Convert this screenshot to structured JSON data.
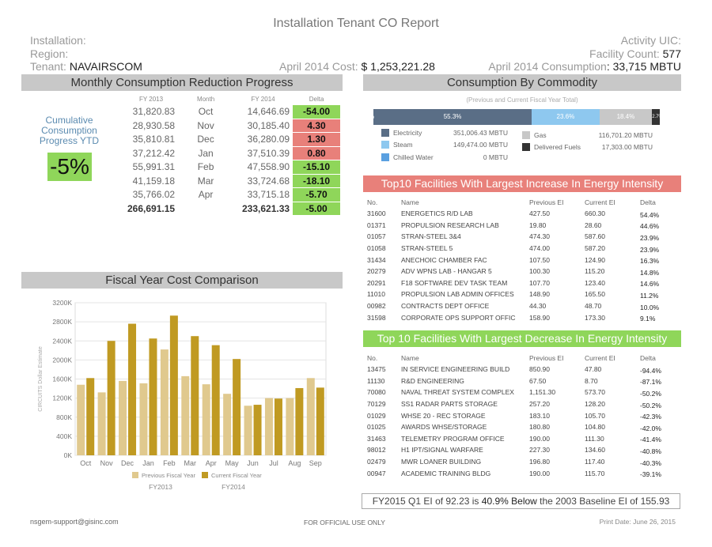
{
  "report": {
    "title": "Installation Tenant CO Report",
    "installation_label": "Installation:",
    "region_label": "Region:",
    "tenant_label": "Tenant:",
    "tenant_value": "NAVAIRSCOM",
    "activity_uic_label": "Activity UIC:",
    "facility_count_label": "Facility Count:",
    "facility_count_value": "577",
    "cost_label": "April 2014 Cost:",
    "cost_value": "$ 1,253,221.28",
    "consumption_label": "April 2014 Consumption",
    "consumption_value": ": 33,715 MBTU"
  },
  "monthly": {
    "title": "Monthly Consumption Reduction Progress",
    "headers": [
      "FY 2013",
      "Month",
      "FY 2014",
      "Delta"
    ],
    "rows": [
      {
        "fy13": "31,820.83",
        "month": "Oct",
        "fy14": "14,646.69",
        "delta": "-54.00",
        "status": "green"
      },
      {
        "fy13": "28,930.58",
        "month": "Nov",
        "fy14": "30,185.40",
        "delta": "4.30",
        "status": "red"
      },
      {
        "fy13": "35,810.81",
        "month": "Dec",
        "fy14": "36,280.09",
        "delta": "1.30",
        "status": "red"
      },
      {
        "fy13": "37,212.42",
        "month": "Jan",
        "fy14": "37,510.39",
        "delta": "0.80",
        "status": "red"
      },
      {
        "fy13": "55,991.31",
        "month": "Feb",
        "fy14": "47,558.90",
        "delta": "-15.10",
        "status": "green"
      },
      {
        "fy13": "41,159.18",
        "month": "Mar",
        "fy14": "33,724.68",
        "delta": "-18.10",
        "status": "green"
      },
      {
        "fy13": "35,766.02",
        "month": "Apr",
        "fy14": "33,715.18",
        "delta": "-5.70",
        "status": "green"
      }
    ],
    "total": {
      "fy13": "266,691.15",
      "fy14": "233,621.33",
      "delta": "-5.00"
    },
    "cumulative_label_1": "Cumulative",
    "cumulative_label_2": "Consumption",
    "cumulative_label_3": "Progress YTD",
    "cumulative_value": "-5%"
  },
  "commodity": {
    "title": "Consumption By Commodity",
    "subtitle": "(Previous and Current Fiscal Year Total)",
    "segments": [
      {
        "label": "55.3%",
        "share": 0.553,
        "color": "#5a6e86"
      },
      {
        "label": "23.6%",
        "share": 0.236,
        "color": "#8ec8ef"
      },
      {
        "label": "18.4%",
        "share": 0.184,
        "color": "#c8c8c8"
      },
      {
        "label": "2.7%",
        "share": 0.027,
        "color": "#333333"
      }
    ],
    "left_cut_label": "%",
    "legend": [
      {
        "name": "Electricity",
        "value": "351,006.43 MBTU",
        "color": "#5a6e86"
      },
      {
        "name": "Steam",
        "value": "149,474.00 MBTU",
        "color": "#8ec8ef"
      },
      {
        "name": "Chilled Water",
        "value": "0 MBTU",
        "color": "#5aa0e0"
      },
      {
        "name": "Gas",
        "value": "116,701.20 MBTU",
        "color": "#c8c8c8"
      },
      {
        "name": "Delivered Fuels",
        "value": "17,303.00 MBTU",
        "color": "#333333"
      }
    ]
  },
  "increase": {
    "title": "Top10 Facilities With Largest Increase In Energy Intensity",
    "headers": [
      "No.",
      "Name",
      "Previous EI",
      "Current EI",
      "Delta"
    ],
    "rows": [
      [
        "31600",
        "ENERGETICS R/D LAB",
        "427.50",
        "660.30",
        "54.4%"
      ],
      [
        "01371",
        "PROPULSION RESEARCH LAB",
        "19.80",
        "28.60",
        "44.6%"
      ],
      [
        "01057",
        "STRAN-STEEL 3&4",
        "474.30",
        "587.60",
        "23.9%"
      ],
      [
        "01058",
        "STRAN-STEEL 5",
        "474.00",
        "587.20",
        "23.9%"
      ],
      [
        "31434",
        "ANECHOIC CHAMBER FAC",
        "107.50",
        "124.90",
        "16.3%"
      ],
      [
        "20279",
        "ADV WPNS LAB - HANGAR 5",
        "100.30",
        "115.20",
        "14.8%"
      ],
      [
        "20291",
        "F18 SOFTWARE DEV TASK TEAM",
        "107.70",
        "123.40",
        "14.6%"
      ],
      [
        "11010",
        "PROPULSION LAB ADMIN OFFICES",
        "148.90",
        "165.50",
        "11.2%"
      ],
      [
        "00982",
        "CONTRACTS DEPT OFFICE",
        "44.30",
        "48.70",
        "10.0%"
      ],
      [
        "31598",
        "CORPORATE OPS SUPPORT OFFIC",
        "158.90",
        "173.30",
        "9.1%"
      ]
    ]
  },
  "decrease": {
    "title": "Top 10 Facilities With Largest Decrease In Energy Intensity",
    "headers": [
      "No.",
      "Name",
      "Previous EI",
      "Current EI",
      "Delta"
    ],
    "rows": [
      [
        "13475",
        "IN SERVICE ENGINEERING BUILD",
        "850.90",
        "47.80",
        "-94.4%"
      ],
      [
        "11130",
        "R&D ENGINEERING",
        "67.50",
        "8.70",
        "-87.1%"
      ],
      [
        "70080",
        "NAVAL THREAT SYSTEM COMPLEX",
        "1,151.30",
        "573.70",
        "-50.2%"
      ],
      [
        "70129",
        "SS1 RADAR PARTS STORAGE",
        "257.20",
        "128.20",
        "-50.2%"
      ],
      [
        "01029",
        "WHSE 20 - REC STORAGE",
        "183.10",
        "105.70",
        "-42.3%"
      ],
      [
        "01025",
        "AWARDS WHSE/STORAGE",
        "180.80",
        "104.80",
        "-42.0%"
      ],
      [
        "31463",
        "TELEMETRY PROGRAM OFFICE",
        "190.00",
        "111.30",
        "-41.4%"
      ],
      [
        "98012",
        "H1 IPT/SIGNAL WARFARE",
        "227.30",
        "134.60",
        "-40.8%"
      ],
      [
        "02479",
        "MWR LOANER BUILDING",
        "196.80",
        "117.40",
        "-40.3%"
      ],
      [
        "00947",
        "ACADEMIC TRAINING BLDG",
        "190.00",
        "115.70",
        "-39.1%"
      ]
    ]
  },
  "summary": {
    "part1": "FY2015 Q1 EI of 92.23 is ",
    "part2": "40.9% Below",
    "part3": " the 2003 Baseline EI  of 155.93"
  },
  "footer": {
    "email": "nsgem-support@gisinc.com",
    "classification": "FOR OFFICIAL USE ONLY",
    "print_date": "Print Date: June 26, 2015"
  },
  "chart_data": {
    "type": "bar",
    "title": "Fiscal Year Cost Comparison",
    "ylabel": "CIRCUITS Dollar Estimate",
    "categories": [
      "Oct",
      "Nov",
      "Dec",
      "Jan",
      "Feb",
      "Mar",
      "Apr",
      "May",
      "Jun",
      "Jul",
      "Aug",
      "Sep"
    ],
    "yticks": [
      "0K",
      "400K",
      "800K",
      "1200K",
      "1600K",
      "2000K",
      "2400K",
      "2800K",
      "3200K"
    ],
    "ylim": [
      0,
      3200
    ],
    "series": [
      {
        "name": "Previous Fiscal Year",
        "color": "#e0c98e",
        "values": [
          1480,
          1320,
          1560,
          1510,
          2220,
          1660,
          1490,
          1290,
          1040,
          1200,
          1200,
          1620
        ]
      },
      {
        "name": "Current Fiscal Year",
        "color": "#c09a22",
        "values": [
          1620,
          2400,
          2760,
          2450,
          2930,
          2500,
          2310,
          2020,
          1060,
          1190,
          1410,
          1420
        ]
      }
    ],
    "legend_sub": [
      "FY2013",
      "FY2014"
    ],
    "grid": true
  }
}
